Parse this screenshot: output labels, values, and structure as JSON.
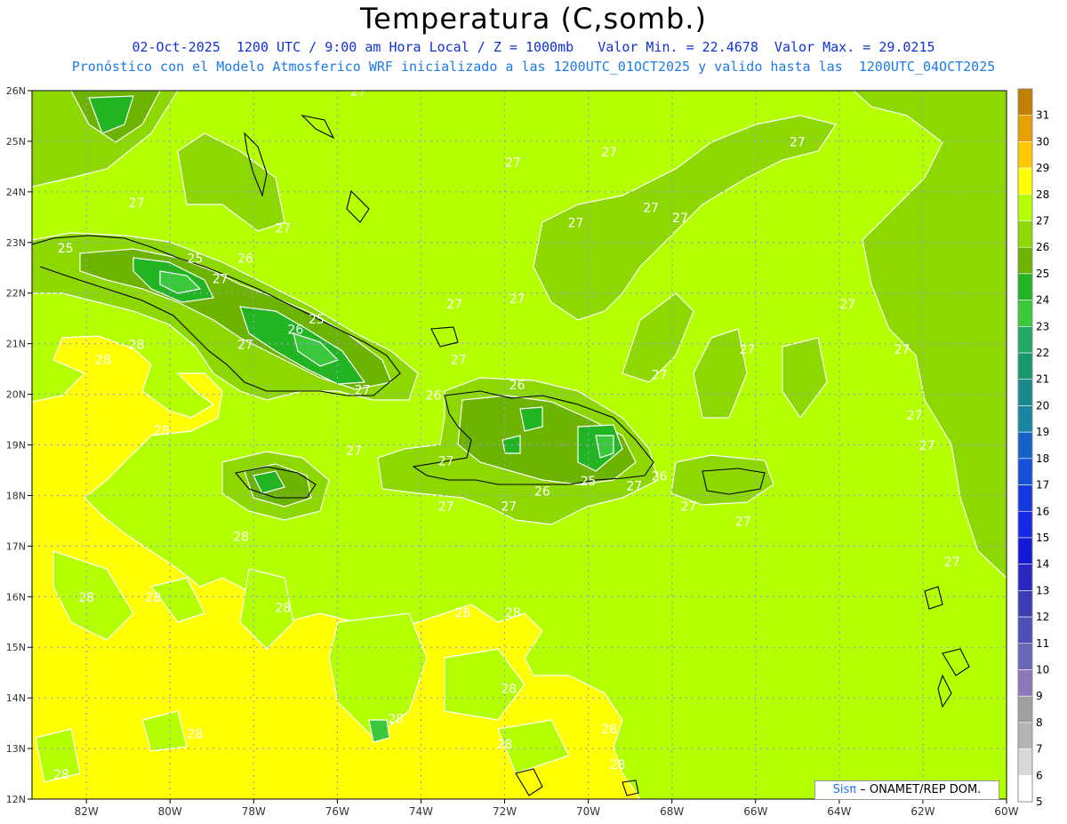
{
  "title": "Temperatura (C,somb.)",
  "subtitle_line1": "02-Oct-2025  1200 UTC / 9:00 am Hora Local / Z = 1000mb   Valor Min. = 22.4678  Valor Max. = 29.0215",
  "subtitle_line2": "Pronóstico con el Modelo Atmosferico WRF inicializado a las 1200UTC_01OCT2025 y valido hasta las  1200UTC_04OCT2025",
  "credit": {
    "brand": "Sisπ",
    "text": " – ONAMET/REP DOM."
  },
  "map": {
    "lon_labels": [
      "82W",
      "80W",
      "78W",
      "76W",
      "74W",
      "72W",
      "70W",
      "68W",
      "66W",
      "64W",
      "62W",
      "60W"
    ],
    "lat_labels": [
      "26N",
      "25N",
      "24N",
      "23N",
      "22N",
      "21N",
      "20N",
      "19N",
      "18N",
      "17N",
      "16N",
      "15N",
      "14N",
      "13N",
      "12N"
    ],
    "lon_range": [
      -83.3,
      -60
    ],
    "lat_range": [
      12,
      26
    ]
  },
  "colorbar": {
    "labels": [
      "31",
      "30",
      "29",
      "28",
      "27",
      "26",
      "25",
      "24",
      "23",
      "22",
      "21",
      "20",
      "19",
      "18",
      "17",
      "16",
      "15",
      "14",
      "13",
      "12",
      "11",
      "10",
      "9",
      "8",
      "7",
      "6",
      "5"
    ],
    "colors": [
      "#c08000",
      "#e8a000",
      "#ffc800",
      "#ffff00",
      "#b4ff00",
      "#8cd800",
      "#6cb400",
      "#22b422",
      "#3cc83c",
      "#22a864",
      "#18986c",
      "#188a8c",
      "#1886a0",
      "#1464c8",
      "#1450dc",
      "#1438e0",
      "#1428e6",
      "#1418d8",
      "#2828c0",
      "#3c3cb4",
      "#5050b4",
      "#6868b8",
      "#8c78b8",
      "#a0a0a0",
      "#b4b4b4",
      "#d8d8d8",
      "#ffffff"
    ]
  },
  "contour_labels": [
    {
      "text": "27",
      "lon": -75.5,
      "lat": 25.9
    },
    {
      "text": "27",
      "lon": -71.8,
      "lat": 24.5
    },
    {
      "text": "27",
      "lon": -69.5,
      "lat": 24.7
    },
    {
      "text": "27",
      "lon": -68.5,
      "lat": 23.6
    },
    {
      "text": "27",
      "lon": -70.3,
      "lat": 23.3
    },
    {
      "text": "27",
      "lon": -67.8,
      "lat": 23.4
    },
    {
      "text": "27",
      "lon": -80.8,
      "lat": 23.7
    },
    {
      "text": "27",
      "lon": -77.3,
      "lat": 23.2
    },
    {
      "text": "27",
      "lon": -65.0,
      "lat": 24.9
    },
    {
      "text": "25",
      "lon": -82.5,
      "lat": 22.8
    },
    {
      "text": "25",
      "lon": -79.4,
      "lat": 22.6
    },
    {
      "text": "26",
      "lon": -78.2,
      "lat": 22.6
    },
    {
      "text": "27",
      "lon": -78.8,
      "lat": 22.2
    },
    {
      "text": "25",
      "lon": -76.5,
      "lat": 21.4
    },
    {
      "text": "26",
      "lon": -77.0,
      "lat": 21.2
    },
    {
      "text": "27",
      "lon": -78.2,
      "lat": 20.9
    },
    {
      "text": "27",
      "lon": -75.4,
      "lat": 20.0
    },
    {
      "text": "26",
      "lon": -73.7,
      "lat": 19.9
    },
    {
      "text": "27",
      "lon": -73.2,
      "lat": 21.7
    },
    {
      "text": "27",
      "lon": -71.7,
      "lat": 21.8
    },
    {
      "text": "27",
      "lon": -73.1,
      "lat": 20.6
    },
    {
      "text": "28",
      "lon": -80.8,
      "lat": 20.9
    },
    {
      "text": "28",
      "lon": -81.6,
      "lat": 20.6
    },
    {
      "text": "27",
      "lon": -68.3,
      "lat": 20.3
    },
    {
      "text": "27",
      "lon": -66.2,
      "lat": 20.8
    },
    {
      "text": "27",
      "lon": -63.8,
      "lat": 21.7
    },
    {
      "text": "27",
      "lon": -62.5,
      "lat": 20.8
    },
    {
      "text": "27",
      "lon": -62.2,
      "lat": 19.5
    },
    {
      "text": "27",
      "lon": -61.9,
      "lat": 18.9
    },
    {
      "text": "26",
      "lon": -71.7,
      "lat": 20.1
    },
    {
      "text": "28",
      "lon": -80.2,
      "lat": 19.2
    },
    {
      "text": "27",
      "lon": -75.6,
      "lat": 18.8
    },
    {
      "text": "27",
      "lon": -73.4,
      "lat": 18.6
    },
    {
      "text": "26",
      "lon": -71.1,
      "lat": 18.0
    },
    {
      "text": "25",
      "lon": -70.0,
      "lat": 18.2
    },
    {
      "text": "27",
      "lon": -68.9,
      "lat": 18.1
    },
    {
      "text": "26",
      "lon": -68.3,
      "lat": 18.3
    },
    {
      "text": "27",
      "lon": -73.4,
      "lat": 17.7
    },
    {
      "text": "27",
      "lon": -71.9,
      "lat": 17.7
    },
    {
      "text": "27",
      "lon": -67.6,
      "lat": 17.7
    },
    {
      "text": "27",
      "lon": -66.3,
      "lat": 17.4
    },
    {
      "text": "27",
      "lon": -61.3,
      "lat": 16.6
    },
    {
      "text": "28",
      "lon": -78.3,
      "lat": 17.1
    },
    {
      "text": "28",
      "lon": -82.0,
      "lat": 15.9
    },
    {
      "text": "28",
      "lon": -80.4,
      "lat": 15.9
    },
    {
      "text": "28",
      "lon": -77.3,
      "lat": 15.7
    },
    {
      "text": "28",
      "lon": -73.0,
      "lat": 15.6
    },
    {
      "text": "28",
      "lon": -71.8,
      "lat": 15.6
    },
    {
      "text": "28",
      "lon": -71.9,
      "lat": 14.1
    },
    {
      "text": "28",
      "lon": -74.6,
      "lat": 13.5
    },
    {
      "text": "28",
      "lon": -79.4,
      "lat": 13.2
    },
    {
      "text": "28",
      "lon": -72.0,
      "lat": 13.0
    },
    {
      "text": "28",
      "lon": -69.5,
      "lat": 13.3
    },
    {
      "text": "28",
      "lon": -82.6,
      "lat": 12.4
    },
    {
      "text": "28",
      "lon": -69.3,
      "lat": 12.6
    }
  ]
}
